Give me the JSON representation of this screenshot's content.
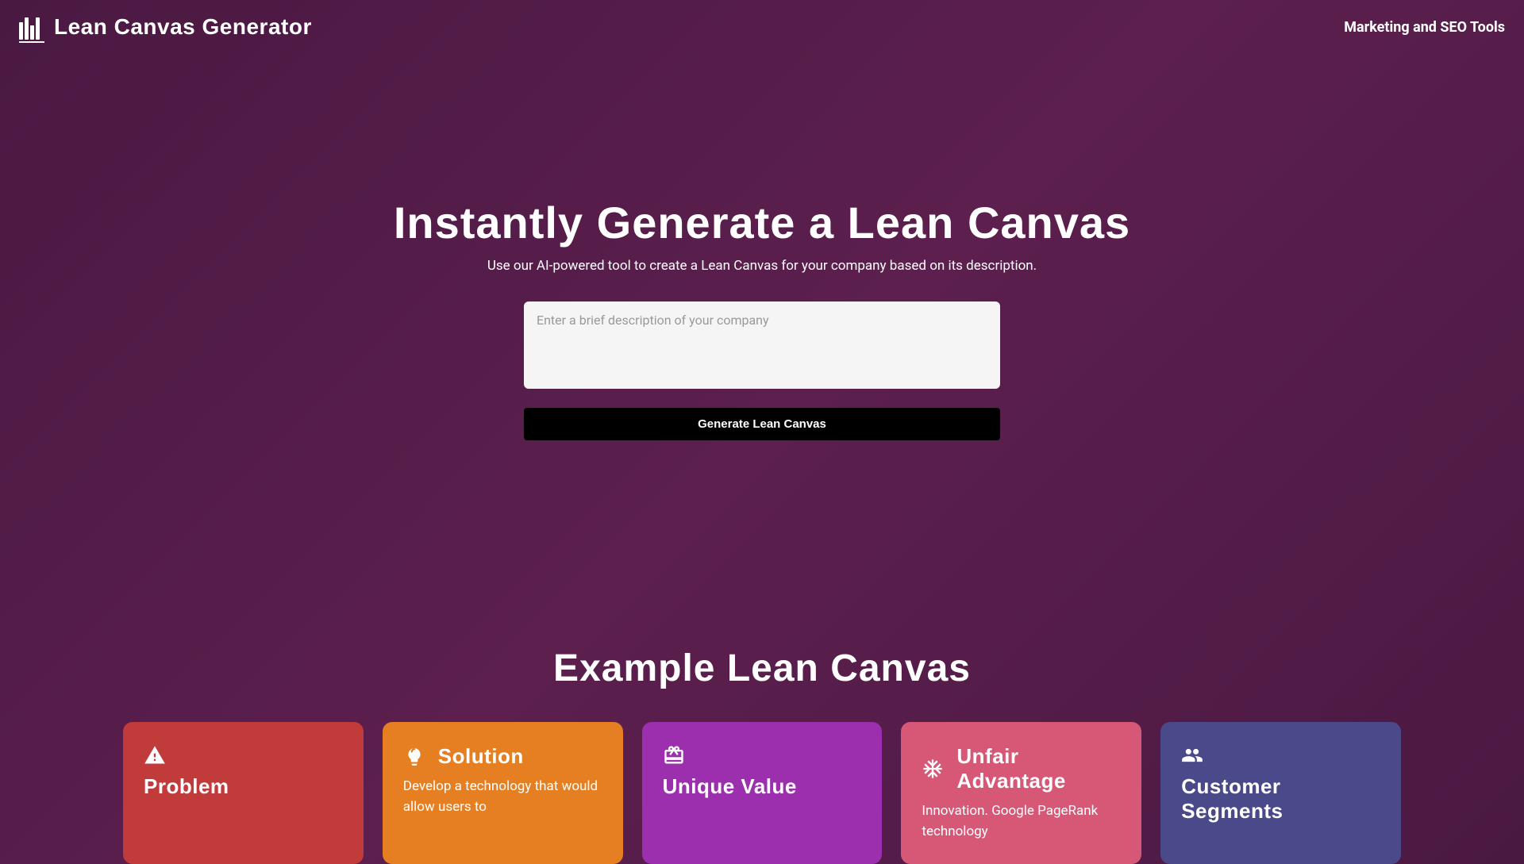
{
  "header": {
    "logo_text": "Lean Canvas Generator",
    "nav_link": "Marketing and SEO Tools"
  },
  "hero": {
    "title": "Instantly Generate a Lean Canvas",
    "subtitle": "Use our AI-powered tool to create a Lean Canvas for your company based on its description.",
    "input_placeholder": "Enter a brief description of your company",
    "button_label": "Generate Lean Canvas"
  },
  "example": {
    "title": "Example Lean Canvas",
    "cards": [
      {
        "title": "Problem",
        "body": "",
        "color": "#c23b3b",
        "icon": "warning"
      },
      {
        "title": "Solution",
        "body": "Develop a technology that would allow users to",
        "color": "#e67e22",
        "icon": "lightbulb"
      },
      {
        "title": "Unique Value",
        "body": "",
        "color": "#9b2fad",
        "icon": "gift"
      },
      {
        "title": "Unfair Advantage",
        "body": "Innovation. Google PageRank technology",
        "color": "#d65776",
        "icon": "snowflake"
      },
      {
        "title": "Customer Segments",
        "body": "",
        "color": "#4a4a8a",
        "icon": "people"
      }
    ]
  }
}
